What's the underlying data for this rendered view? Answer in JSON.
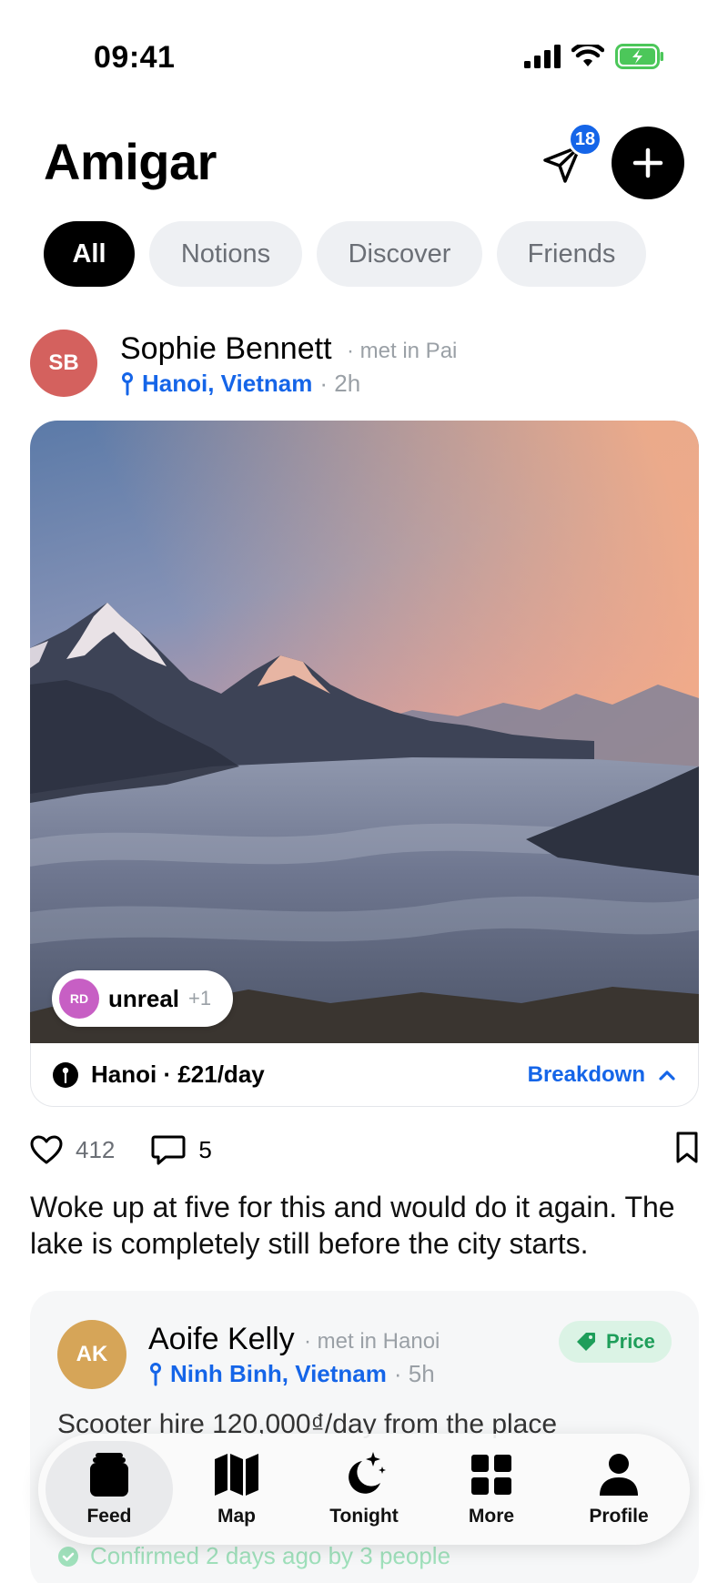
{
  "status_bar": {
    "time": "09:41"
  },
  "header": {
    "title": "Amigar",
    "notification_count": "18"
  },
  "tabs": [
    {
      "label": "All",
      "active": true
    },
    {
      "label": "Notions",
      "active": false
    },
    {
      "label": "Discover",
      "active": false
    },
    {
      "label": "Friends",
      "active": false
    }
  ],
  "post1": {
    "initials": "SB",
    "author": "Sophie Bennett",
    "met": "· met in Pai",
    "location": "Hanoi, Vietnam",
    "time": "· 2h",
    "reaction": {
      "initials": "RD",
      "label": "unreal",
      "extra": "+1"
    },
    "cost": "Hanoi · £21/day",
    "breakdown_label": "Breakdown",
    "likes": "412",
    "comments": "5",
    "caption": "Woke up at five for this and would do it again. The lake is completely still before the city starts."
  },
  "post2": {
    "initials": "AK",
    "author": "Aoife Kelly",
    "met": "· met in Hanoi",
    "location": "Ninh Binh, Vietnam",
    "time": "· 5h",
    "tag": "Price",
    "text": "Scooter hire 120,000₫/day from the place",
    "confirmed": "Confirmed 2 days ago by 3 people"
  },
  "nav": [
    {
      "label": "Feed",
      "icon": "feed-icon",
      "active": true
    },
    {
      "label": "Map",
      "icon": "map-icon",
      "active": false
    },
    {
      "label": "Tonight",
      "icon": "moon-stars-icon",
      "active": false
    },
    {
      "label": "More",
      "icon": "grid-icon",
      "active": false
    },
    {
      "label": "Profile",
      "icon": "person-icon",
      "active": false
    }
  ],
  "colors": {
    "accent": "#1565e8",
    "price_green": "#1e9e5a",
    "avatar_sb": "#d4615e",
    "avatar_ak": "#d6a558",
    "avatar_rd": "#c75fc4"
  }
}
